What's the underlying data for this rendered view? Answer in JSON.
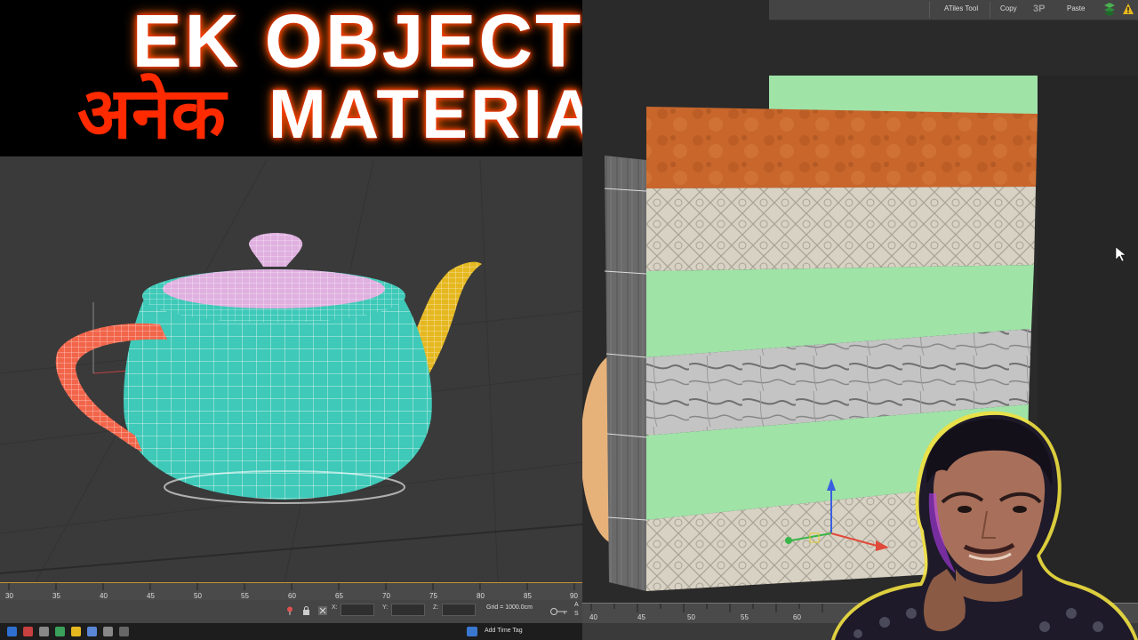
{
  "title": {
    "line1": "EK OBJECT",
    "line2_hindi": "अनेक",
    "line2_english": "MATERIALS"
  },
  "toolbar": {
    "atiles_label": "ATiles Tool",
    "copy_label": "Copy",
    "paste_label": "Paste",
    "logo_icon": "3p-logo-icon",
    "layers_icon": "layers-icon",
    "warning_icon": "warning-icon"
  },
  "timeline_left": {
    "ticks": [
      "30",
      "35",
      "40",
      "45",
      "50",
      "55",
      "60",
      "65",
      "70",
      "75",
      "80",
      "85",
      "90"
    ]
  },
  "status": {
    "x_label": "X:",
    "y_label": "Y:",
    "z_label": "Z:",
    "grid_text": "Grid = 1000.0cm",
    "add_time_tag": "Add Time Tag",
    "right_stub1": "A",
    "right_stub2": "S"
  },
  "timeline_right": {
    "ticks": [
      "40",
      "45",
      "50",
      "55",
      "60"
    ]
  },
  "colors": {
    "accent_red": "#ff2a00",
    "teapot_body": "#3ec9b8",
    "teapot_lid": "#e0b0e0",
    "teapot_handle": "#f2654a",
    "teapot_spout": "#e6b820",
    "wall_green": "#9fe3a7",
    "wall_rust": "#c8662c",
    "wall_marble": "#c8c8c8",
    "wall_pattern": "#d8d2c4"
  }
}
